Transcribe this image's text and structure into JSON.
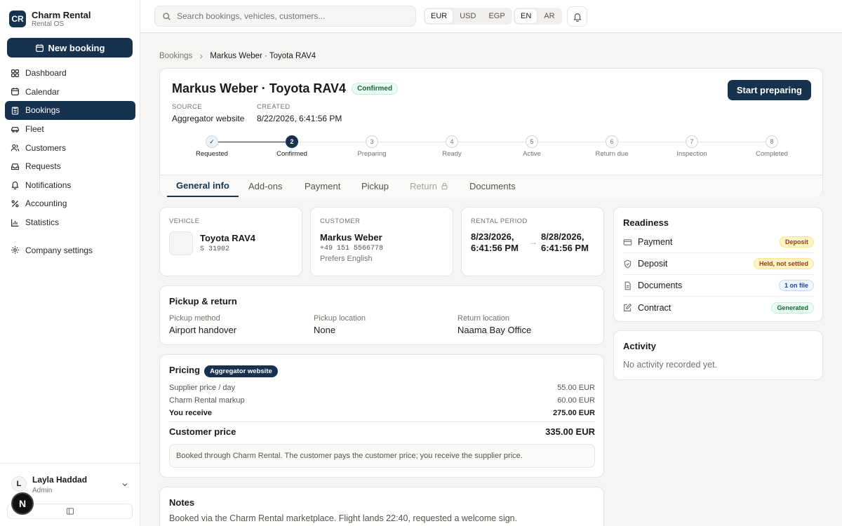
{
  "brand": {
    "initials": "CR",
    "name": "Charm Rental",
    "subtitle": "Rental OS"
  },
  "sidebar": {
    "new_booking": "New booking",
    "items": [
      {
        "label": "Dashboard",
        "icon": "grid-icon"
      },
      {
        "label": "Calendar",
        "icon": "calendar-icon"
      },
      {
        "label": "Bookings",
        "icon": "clipboard-icon",
        "active": true
      },
      {
        "label": "Fleet",
        "icon": "car-icon"
      },
      {
        "label": "Customers",
        "icon": "users-icon"
      },
      {
        "label": "Requests",
        "icon": "inbox-icon"
      },
      {
        "label": "Notifications",
        "icon": "bell-icon"
      },
      {
        "label": "Accounting",
        "icon": "percent-icon"
      },
      {
        "label": "Statistics",
        "icon": "bar-chart-icon"
      },
      {
        "label": "Company settings",
        "icon": "gear-icon"
      }
    ],
    "user": {
      "initial": "L",
      "name": "Layla Haddad",
      "role": "Admin"
    }
  },
  "topbar": {
    "search_placeholder": "Search bookings, vehicles, customers...",
    "currencies": [
      "EUR",
      "USD",
      "EGP"
    ],
    "currency_selected": "EUR",
    "languages": [
      "EN",
      "AR"
    ],
    "language_selected": "EN"
  },
  "breadcrumb": {
    "root": "Bookings",
    "current": "Markus Weber · Toyota RAV4"
  },
  "header": {
    "title": "Markus Weber · Toyota RAV4",
    "status": "Confirmed",
    "action": "Start preparing",
    "source_label": "SOURCE",
    "source_value": "Aggregator website",
    "created_label": "CREATED",
    "created_value": "8/22/2026, 6:41:56 PM"
  },
  "steps": [
    {
      "num": "✓",
      "label": "Requested",
      "state": "done"
    },
    {
      "num": "2",
      "label": "Confirmed",
      "state": "current"
    },
    {
      "num": "3",
      "label": "Preparing",
      "state": "todo"
    },
    {
      "num": "4",
      "label": "Ready",
      "state": "todo"
    },
    {
      "num": "5",
      "label": "Active",
      "state": "todo"
    },
    {
      "num": "6",
      "label": "Return due",
      "state": "todo"
    },
    {
      "num": "7",
      "label": "Inspection",
      "state": "todo"
    },
    {
      "num": "8",
      "label": "Completed",
      "state": "todo"
    }
  ],
  "tabs": [
    {
      "label": "General info",
      "active": true
    },
    {
      "label": "Add-ons"
    },
    {
      "label": "Payment"
    },
    {
      "label": "Pickup"
    },
    {
      "label": "Return",
      "locked": true
    },
    {
      "label": "Documents"
    }
  ],
  "vehicle": {
    "label": "VEHICLE",
    "name": "Toyota RAV4",
    "plate": "S 31902"
  },
  "customer": {
    "label": "CUSTOMER",
    "name": "Markus Weber",
    "phone": "+49 151 5566778",
    "language": "Prefers English"
  },
  "rental_period": {
    "label": "RENTAL PERIOD",
    "start_date": "8/23/2026,",
    "start_time": "6:41:56 PM",
    "end_date": "8/28/2026,",
    "end_time": "6:41:56 PM",
    "arrow": "→"
  },
  "pickup_return": {
    "title": "Pickup & return",
    "method_label": "Pickup method",
    "method_value": "Airport handover",
    "pickup_label": "Pickup location",
    "pickup_value": "None",
    "return_label": "Return location",
    "return_value": "Naama Bay Office"
  },
  "pricing": {
    "title": "Pricing",
    "badge": "Aggregator website",
    "rows": [
      {
        "label": "Supplier price / day",
        "value": "55.00 EUR"
      },
      {
        "label": "Charm Rental markup",
        "value": "60.00 EUR"
      },
      {
        "label": "You receive",
        "value": "275.00 EUR"
      }
    ],
    "total_label": "Customer price",
    "total_value": "335.00 EUR",
    "note": "Booked through Charm Rental. The customer pays the customer price; you receive the supplier price."
  },
  "notes": {
    "title": "Notes",
    "text": "Booked via the Charm Rental marketplace. Flight lands 22:40, requested a welcome sign."
  },
  "readiness": {
    "title": "Readiness",
    "items": [
      {
        "label": "Payment",
        "tag": "Deposit",
        "tone": "amber",
        "icon": "card-icon"
      },
      {
        "label": "Deposit",
        "tag": "Held, not settled",
        "tone": "amber",
        "icon": "shield-icon"
      },
      {
        "label": "Documents",
        "tag": "1 on file",
        "tone": "blue",
        "icon": "file-icon"
      },
      {
        "label": "Contract",
        "tag": "Generated",
        "tone": "green",
        "icon": "edit-icon"
      }
    ]
  },
  "activity": {
    "title": "Activity",
    "empty": "No activity recorded yet."
  },
  "floating_badge": "N",
  "colors": {
    "primary": "#16324f",
    "background": "#f5f5f4",
    "border": "#e7e5e4"
  }
}
